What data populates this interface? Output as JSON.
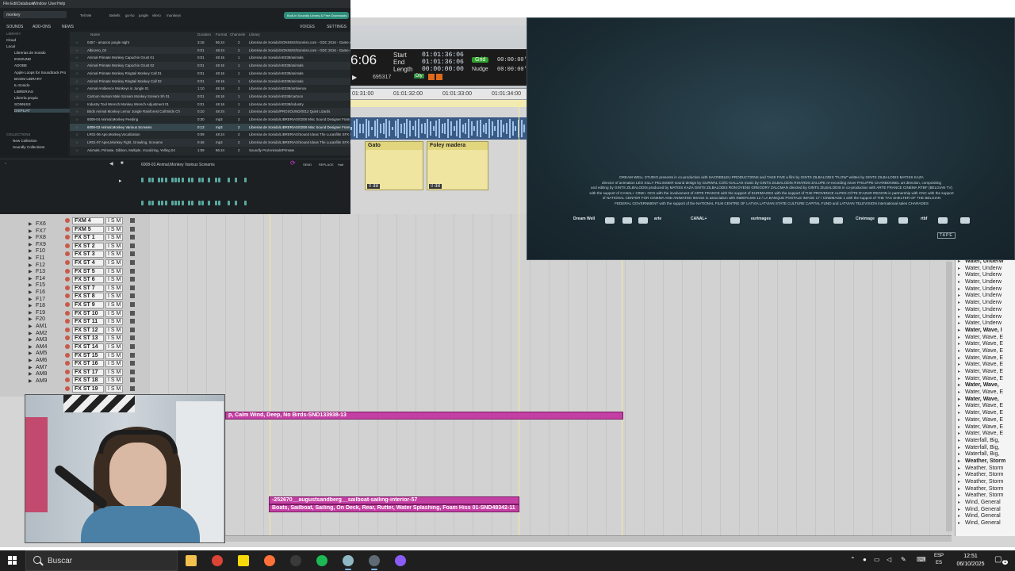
{
  "protools": {
    "counter_main": "6:06",
    "start_label": "Start",
    "end_label": "End",
    "length_label": "Length",
    "start_value": "01:01:36:06",
    "end_value": "01:01:36:06",
    "length_value": "00:00:00:00",
    "grid_label": "Grid",
    "grid_value": "00:00:00'",
    "nudge_label": "Nudge",
    "nudge_value": "00:00:00'",
    "sample_value": "695317",
    "dly_label": "Dly",
    "ruler_ticks": [
      "01:31:00",
      "01:01:32:00",
      "01:01:33:00",
      "01:01:34:00"
    ],
    "clip_gato": "Gato",
    "clip_foley": "Foley madera",
    "clip_db": "0 dB",
    "tracks_small": [
      "FX6",
      "FX7",
      "FX8",
      "FX9",
      "F10",
      "F11",
      "F12",
      "F13",
      "F14",
      "F15",
      "F16",
      "F17",
      "F18",
      "F19",
      "F20",
      "AM1",
      "AM2",
      "AM3",
      "AM4",
      "AM5",
      "AM6",
      "AM7",
      "AM8",
      "AM9"
    ],
    "tracks_big": [
      "FXM 4",
      "FXM 5",
      "FX ST 1",
      "FX ST 2",
      "FX ST 3",
      "FX ST 4",
      "FX ST 5",
      "FX ST 6",
      "FX ST 7",
      "FX ST 8",
      "FX ST 9",
      "FX ST 10",
      "FX ST 11",
      "FX ST 12",
      "FX ST 13",
      "FX ST 14",
      "FX ST 15",
      "FX ST 16",
      "FX ST 17",
      "FX ST 18",
      "FX ST 19"
    ],
    "ism_label": "I S M",
    "pink_clip_1": "p, Calm Wind, Deep, No Birds-SND133938-13",
    "pink_clip_2": "-252670__augustsandberg__sailboat-sailing-interior-57",
    "pink_clip_3": "Boats, Sailboat, Sailing, On Deck, Rear, Rutter, Water Splashing, Foam Hiss 01-SND48342-11",
    "right_list": [
      {
        "t": "Water, Underw",
        "b": true
      },
      {
        "t": "Water, Underw",
        "b": false
      },
      {
        "t": "Water, Underw",
        "b": false
      },
      {
        "t": "Water, Underw",
        "b": false
      },
      {
        "t": "Water, Underw",
        "b": false
      },
      {
        "t": "Water, Underw",
        "b": false
      },
      {
        "t": "Water, Underw",
        "b": false
      },
      {
        "t": "Water, Underw",
        "b": false
      },
      {
        "t": "Water, Underw",
        "b": false
      },
      {
        "t": "Water, Underw",
        "b": false
      },
      {
        "t": "Water, Wave, I",
        "b": true
      },
      {
        "t": "Water, Wave, E",
        "b": false
      },
      {
        "t": "Water, Wave, E",
        "b": false
      },
      {
        "t": "Water, Wave, E",
        "b": false
      },
      {
        "t": "Water, Wave, E",
        "b": false
      },
      {
        "t": "Water, Wave, E",
        "b": false
      },
      {
        "t": "Water, Wave, E",
        "b": false
      },
      {
        "t": "Water, Wave, E",
        "b": false
      },
      {
        "t": "Water, Wave,",
        "b": true
      },
      {
        "t": "Water, Wave, E",
        "b": false
      },
      {
        "t": "Water, Wave,",
        "b": true
      },
      {
        "t": "Water, Wave, E",
        "b": false
      },
      {
        "t": "Water, Wave, E",
        "b": false
      },
      {
        "t": "Water, Wave, E",
        "b": false
      },
      {
        "t": "Water, Wave, E",
        "b": false
      },
      {
        "t": "Water, Wave, E",
        "b": false
      },
      {
        "t": "Waterfall, Big,",
        "b": false
      },
      {
        "t": "Waterfall, Big,",
        "b": false
      },
      {
        "t": "Waterfall, Big,",
        "b": false
      },
      {
        "t": "Weather, Storm",
        "b": true
      },
      {
        "t": "Weather, Storm",
        "b": false
      },
      {
        "t": "Weather, Storm",
        "b": false
      },
      {
        "t": "Weather, Storm",
        "b": false
      },
      {
        "t": "Weather, Storm",
        "b": false
      },
      {
        "t": "Weather, Storm",
        "b": false
      },
      {
        "t": "Wind, General",
        "b": false
      },
      {
        "t": "Wind, General",
        "b": false
      },
      {
        "t": "Wind, General",
        "b": false
      },
      {
        "t": "Wind, General",
        "b": false
      }
    ]
  },
  "soundly": {
    "menu": [
      "File",
      "Edit",
      "Database",
      "Window",
      "User",
      "Help"
    ],
    "search_value": "monkey",
    "top_filters": [
      "Tell Me",
      "Beliefs",
      "go-ho",
      "jungle",
      "vilero",
      "monkeys"
    ],
    "banner": "Built-In Soundly Library & Free Downloads",
    "tabs": [
      "SOUNDS",
      "ADD-ONS",
      "NEWS"
    ],
    "tabs_right": [
      "VOICES",
      "SETTINGS"
    ],
    "sidebar_sections": [
      "LIBRARY",
      "COLLECTIONS"
    ],
    "sidebar_items": [
      "Cloud",
      "Local",
      "Librerias de Sonido",
      "INSOUND",
      "ADOBE",
      "Apple Loops for Soundtrack Pro",
      "BOOM LIBRARY",
      "tu Sonido",
      "LIBRERIAS",
      "Librería propia",
      "SONNISS",
      "DISPLIAT"
    ],
    "collection_items": [
      "New Collection",
      "Soundly Collections"
    ],
    "columns": [
      "Name",
      "Duration",
      "Format",
      "Channels",
      "Library"
    ],
    "rows": [
      {
        "name": "0457 - amazon jungle night",
        "dur": "3:18",
        "fmt": "96 24",
        "ch": "2",
        "lib": "Librerias de Sonido/SONNISS/Sonniss.com - GDC 2016 - Game A"
      },
      {
        "name": "Albiceno_02",
        "dur": "0:01",
        "fmt": "48 24",
        "ch": "2",
        "lib": "Librerias de Sonido/SONNISS/Sonniss.com - GDC 2016 - Game A"
      },
      {
        "name": "Animal Primate Monkey Capuchin Grunt 01",
        "dur": "0:01",
        "fmt": "48 16",
        "ch": "1",
        "lib": "Librerias de Sonido/AE038/animals"
      },
      {
        "name": "Animal Primate Monkey Capuchin Grunt 02",
        "dur": "0:01",
        "fmt": "48 16",
        "ch": "1",
        "lib": "Librerias de Sonido/AE038/animals"
      },
      {
        "name": "Animal Primate Monkey Ringtail Monkey Call 01",
        "dur": "0:01",
        "fmt": "48 16",
        "ch": "1",
        "lib": "Librerias de Sonido/AE038/animals"
      },
      {
        "name": "Animal Primate Monkey Ringtail Monkey Call 02",
        "dur": "0:01",
        "fmt": "48 16",
        "ch": "1",
        "lib": "Librerias de Sonido/AE038/animals"
      },
      {
        "name": "Animal Ambience Monkeys in Jungle 01",
        "dur": "1:10",
        "fmt": "48 16",
        "ch": "2",
        "lib": "Librerias de Sonido/AE038/ambience"
      },
      {
        "name": "Cartoon Human Male Scream Monkey Scream Sh 01",
        "dur": "0:01",
        "fmt": "48 16",
        "ch": "1",
        "lib": "Librerias de Sonido/AE038/cartoon"
      },
      {
        "name": "Industry Tool Wrench Monkey Wrench Adjustment 01",
        "dur": "0:01",
        "fmt": "48 16",
        "ch": "1",
        "lib": "Librerias de Sonido/AE038/industry"
      },
      {
        "name": "Birds Animal Monkey Lemur Jungle Rainforest Call Birds Ch",
        "dur": "0:10",
        "fmt": "48 24",
        "ch": "2",
        "lib": "Librerias de Sonido/PROSOUND/0012 Quiet Lizards"
      },
      {
        "name": "6008-04 Animal,Monkey Feeding",
        "dur": "0:30",
        "fmt": "mp3",
        "ch": "2",
        "lib": "Librerias de Sonido/LIBRERIAS/0208 Misc Sound Designer Fram"
      },
      {
        "name": "6008-03 Animal,Monkey Various Screams",
        "dur": "0:13",
        "fmt": "mp3",
        "ch": "2",
        "lib": "Librerias de Sonido/LIBRERIAS/0208 Misc Sound Designer Fram"
      },
      {
        "name": "LR01-06 Ape,Monkey,Vocalization",
        "dur": "0:09",
        "fmt": "48 24",
        "ch": "2",
        "lib": "Librerias de Sonido/LIBRERIAS/Sound Ideas The Lucasfilm SFX Lib"
      },
      {
        "name": "LR01-07 Apes,Monkey Fight, Growling, Screams",
        "dur": "0:46",
        "fmt": "mp3",
        "ch": "2",
        "lib": "Librerias de Sonido/LIBRERIAS/Sound Ideas The Lucasfilm SFX Lib"
      },
      {
        "name": "Animals, Primate, Gibbon, Multiple, Vocalizing, Yelling 04",
        "dur": "1:09",
        "fmt": "96 24",
        "ch": "2",
        "lib": "Soundly Pro/Animals/Primate"
      }
    ],
    "player_title": "6008-03 Animal,Monkey Various Screams",
    "player_right": [
      "SEND",
      "REPLACE",
      "Halt"
    ]
  },
  "video": {
    "credits": [
      "DREAM WELL STUDIO presents in co-production with SACREBLEU PRODUCTIONS and TAKE FIVE a film by GINTS ZILBALODIS \"FLOW\" written by GINTS ZILBALODIS MATISS KAZA",
      "director of animation LÉO SILLY PELISSIER sound design by GURWAL COÏC-GALLAS music by GINTS ZILBALODIS RIHARDS ZALUPE re-recording mixer PHILIPPE CHARBONNEL art direction, compositing",
      "and editing by GINTS ZILBALODIS produced by MATISS KAZA GINTS ZILBALODIS RON DYENS GREGORY ZALCMAN directed by GINTS ZILBALODIS in co-production with ARTE FRANCE CINEMA RTBF (BELGIAN TV)",
      "with the support of CANAL+ CINE+ OCS with the involvement of ARTE FRANCE with the support of EURIMAGES with the support of THE PROVENCE ALPES-CÔTE D'AZUR REGION in partnership with CNC with the support",
      "of NATIONAL CENTER FOR CINEMA AND ANIMATED IMAGE in association with INDEFILMS 12 / LA BANQUE POSTALE IMAGE 17 / CINEMAGE 1 with the support of THE TAX SHELTER OF THE BELGIAN",
      "FEDERAL GOVERNMENT with the support of the NATIONAL FILM CENTRE OF LATVIA LATVIAN STATE CULTURE CAPITAL FUND and LATVIAN TELEVISION international sales CHARADES"
    ],
    "logos": [
      "Dream Well",
      "arte",
      "CANAL+",
      "eurimages",
      "Cinémage",
      "rtbf",
      "TAPE"
    ]
  },
  "taskbar": {
    "search_placeholder": "Buscar",
    "lang_top": "ESP",
    "lang_bottom": "ES",
    "time": "12:51",
    "date": "06/10/2025",
    "notif_count": "1",
    "apps": [
      {
        "name": "file-explorer",
        "color": "#f2c14e"
      },
      {
        "name": "chrome",
        "color": "#db4437"
      },
      {
        "name": "sticky-notes",
        "color": "#f5d90a"
      },
      {
        "name": "firefox",
        "color": "#ff7139"
      },
      {
        "name": "obs",
        "color": "#3a3a3a"
      },
      {
        "name": "spotify",
        "color": "#1db954"
      },
      {
        "name": "soundly",
        "color": "#8fb8c4"
      },
      {
        "name": "pro-tools",
        "color": "#5f6a74"
      },
      {
        "name": "app-purple",
        "color": "#8a5cf6"
      }
    ]
  }
}
